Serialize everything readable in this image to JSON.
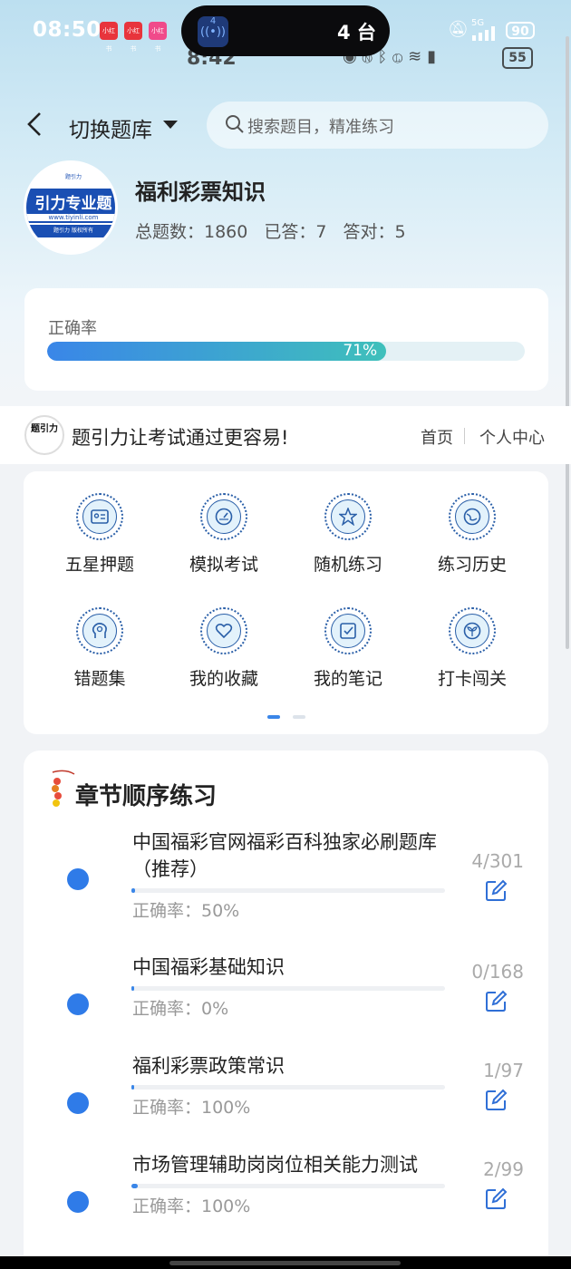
{
  "status_bar": {
    "time": "08:50",
    "apps": [
      "小红书",
      "小红书",
      "小红书"
    ],
    "island_badge": "4",
    "island_text": "4 台",
    "network": "5G",
    "battery": "90",
    "ghost_time": "8:42",
    "ghost_battery": "55"
  },
  "header": {
    "switch_label": "切换题库",
    "search_placeholder": "搜索题目，精准练习"
  },
  "bank": {
    "logo_top": "题引力",
    "logo_title": "引力专业题",
    "logo_url": "www.tiyinli.com",
    "logo_copy": "题引力 版权所有",
    "name": "福利彩票知识",
    "total": "总题数：1860",
    "answered": "已答：7",
    "correct": "答对：5"
  },
  "accuracy": {
    "label": "正确率",
    "value_text": "71%",
    "fraction": 0.71
  },
  "banner": {
    "logo_text": "题引力",
    "slogan": "题引力让考试通过更容易!",
    "home": "首页",
    "profile": "个人中心"
  },
  "grid": [
    {
      "label": "五星押题",
      "icon": "id-card-icon"
    },
    {
      "label": "模拟考试",
      "icon": "gauge-icon"
    },
    {
      "label": "随机练习",
      "icon": "random-star-icon"
    },
    {
      "label": "练习历史",
      "icon": "history-globe-icon"
    },
    {
      "label": "错题集",
      "icon": "brain-head-icon"
    },
    {
      "label": "我的收藏",
      "icon": "heart-icon"
    },
    {
      "label": "我的笔记",
      "icon": "note-check-icon"
    },
    {
      "label": "打卡闯关",
      "icon": "sprout-icon"
    }
  ],
  "chapters": {
    "title": "章节顺序练习",
    "items": [
      {
        "name": "中国福彩官网福彩百科独家必刷题库（推荐）",
        "accuracy": "正确率：50%",
        "count": "4/301",
        "progress": 0.013
      },
      {
        "name": "中国福彩基础知识",
        "accuracy": "正确率：0%",
        "count": "0/168",
        "progress": 0
      },
      {
        "name": "福利彩票政策常识",
        "accuracy": "正确率：100%",
        "count": "1/97",
        "progress": 0.01
      },
      {
        "name": "市场管理辅助岗岗位相关能力测试",
        "accuracy": "正确率：100%",
        "count": "2/99",
        "progress": 0.02
      }
    ]
  },
  "colors": {
    "accent": "#3a86e8",
    "accent_teal": "#3fc0bb",
    "icon_stroke": "#2a5fa8"
  }
}
